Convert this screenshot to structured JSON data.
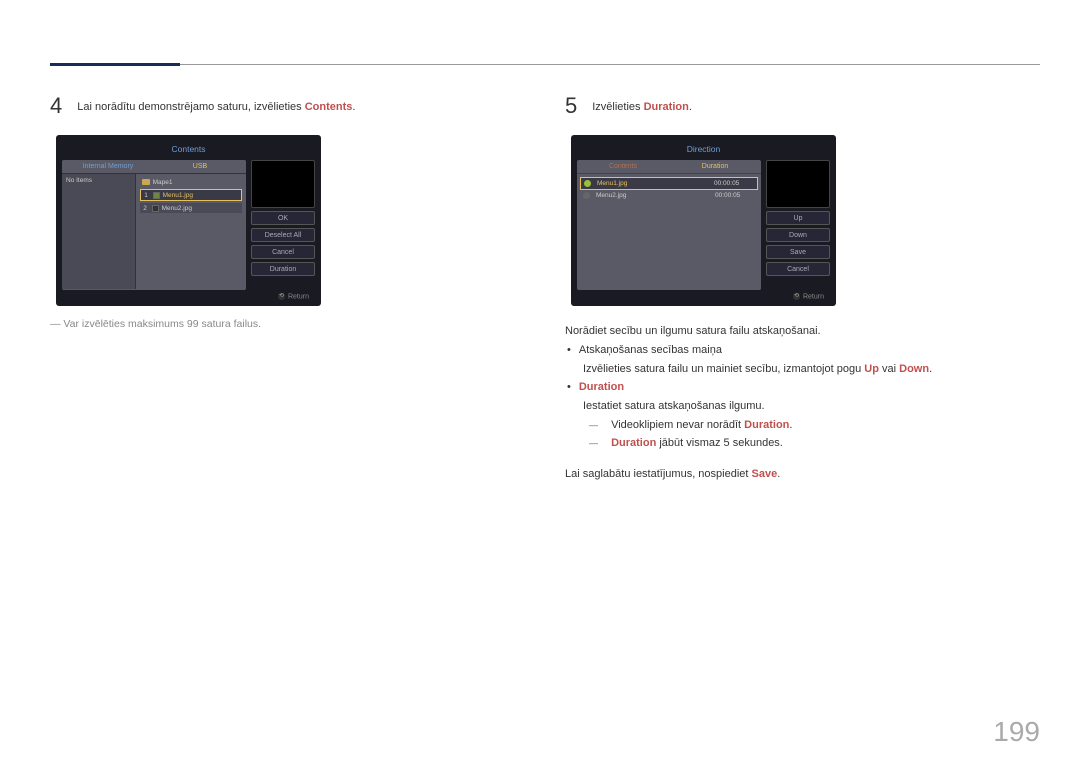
{
  "page_number": "199",
  "left": {
    "step_num": "4",
    "step_text_pre": "Lai norādītu demonstrējamo saturu, izvēlieties ",
    "step_text_hl": "Contents",
    "step_text_post": ".",
    "note": "―  Var izvēlēties maksimums 99 satura failus.",
    "screen": {
      "title": "Contents",
      "tab_im": "Internal Memory",
      "tab_usb": "USB",
      "noitems": "No Items",
      "folder": "Mape1",
      "files": [
        {
          "idx": "1",
          "name": "Menu1.jpg",
          "selected": true,
          "checked": true
        },
        {
          "idx": "2",
          "name": "Menu2.jpg",
          "selected": false,
          "checked": false
        }
      ],
      "buttons": [
        "OK",
        "Deselect All",
        "Cancel",
        "Duration"
      ],
      "return": "Return"
    }
  },
  "right": {
    "step_num": "5",
    "step_text_pre": "Izvēlieties ",
    "step_text_hl": "Duration",
    "step_text_post": ".",
    "screen": {
      "title": "Direction",
      "tab_contents": "Contents",
      "tab_duration": "Duration",
      "rows": [
        {
          "name": "Menu1.jpg",
          "time": "00:00:05",
          "selected": true
        },
        {
          "name": "Menu2.jpg",
          "time": "00:00:05",
          "selected": false
        }
      ],
      "buttons": [
        "Up",
        "Down",
        "Save",
        "Cancel"
      ],
      "return": "Return"
    },
    "para1": "Norādiet secību un ilgumu satura failu atskaņošanai.",
    "bullet1": "Atskaņošanas secības maiņa",
    "bullet1_sub_pre": "Izvēlieties satura failu un mainiet secību, izmantojot pogu ",
    "bullet1_sub_up": "Up",
    "bullet1_sub_mid": " vai ",
    "bullet1_sub_down": "Down",
    "bullet1_sub_post": ".",
    "bullet2": "Duration",
    "bullet2_sub": "Iestatiet satura atskaņošanas ilgumu.",
    "dash1_pre": "Videoklipiem nevar norādīt ",
    "dash1_hl": "Duration",
    "dash1_post": ".",
    "dash2_hl": "Duration",
    "dash2_post": " jābūt vismaz 5 sekundes.",
    "para2_pre": "Lai saglabātu iestatījumus, nospiediet ",
    "para2_hl": "Save",
    "para2_post": "."
  }
}
